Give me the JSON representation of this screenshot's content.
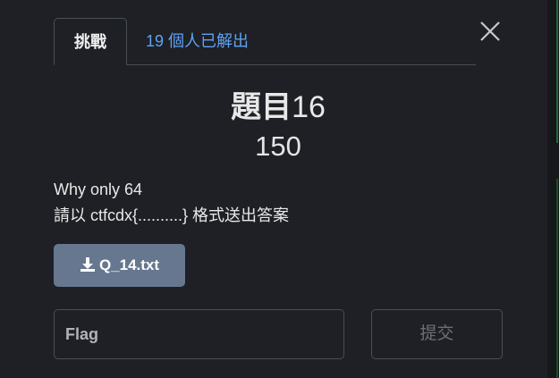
{
  "tabs": {
    "challenge_label": "挑戰",
    "solves_label": "19 個人已解出"
  },
  "challenge": {
    "title_prefix": "題目",
    "title_number": "16",
    "points": "150",
    "description_line1": "Why only 64",
    "description_line2": "請以 ctfcdx{..........} 格式送出答案"
  },
  "file": {
    "label": "Q_14.txt",
    "icon": "download-icon"
  },
  "flag": {
    "placeholder": "Flag",
    "value": ""
  },
  "submit": {
    "label": "提交"
  },
  "colors": {
    "background": "#1e2025",
    "tab_link": "#5ea3f5",
    "file_button": "#66778f",
    "border": "#495057"
  }
}
